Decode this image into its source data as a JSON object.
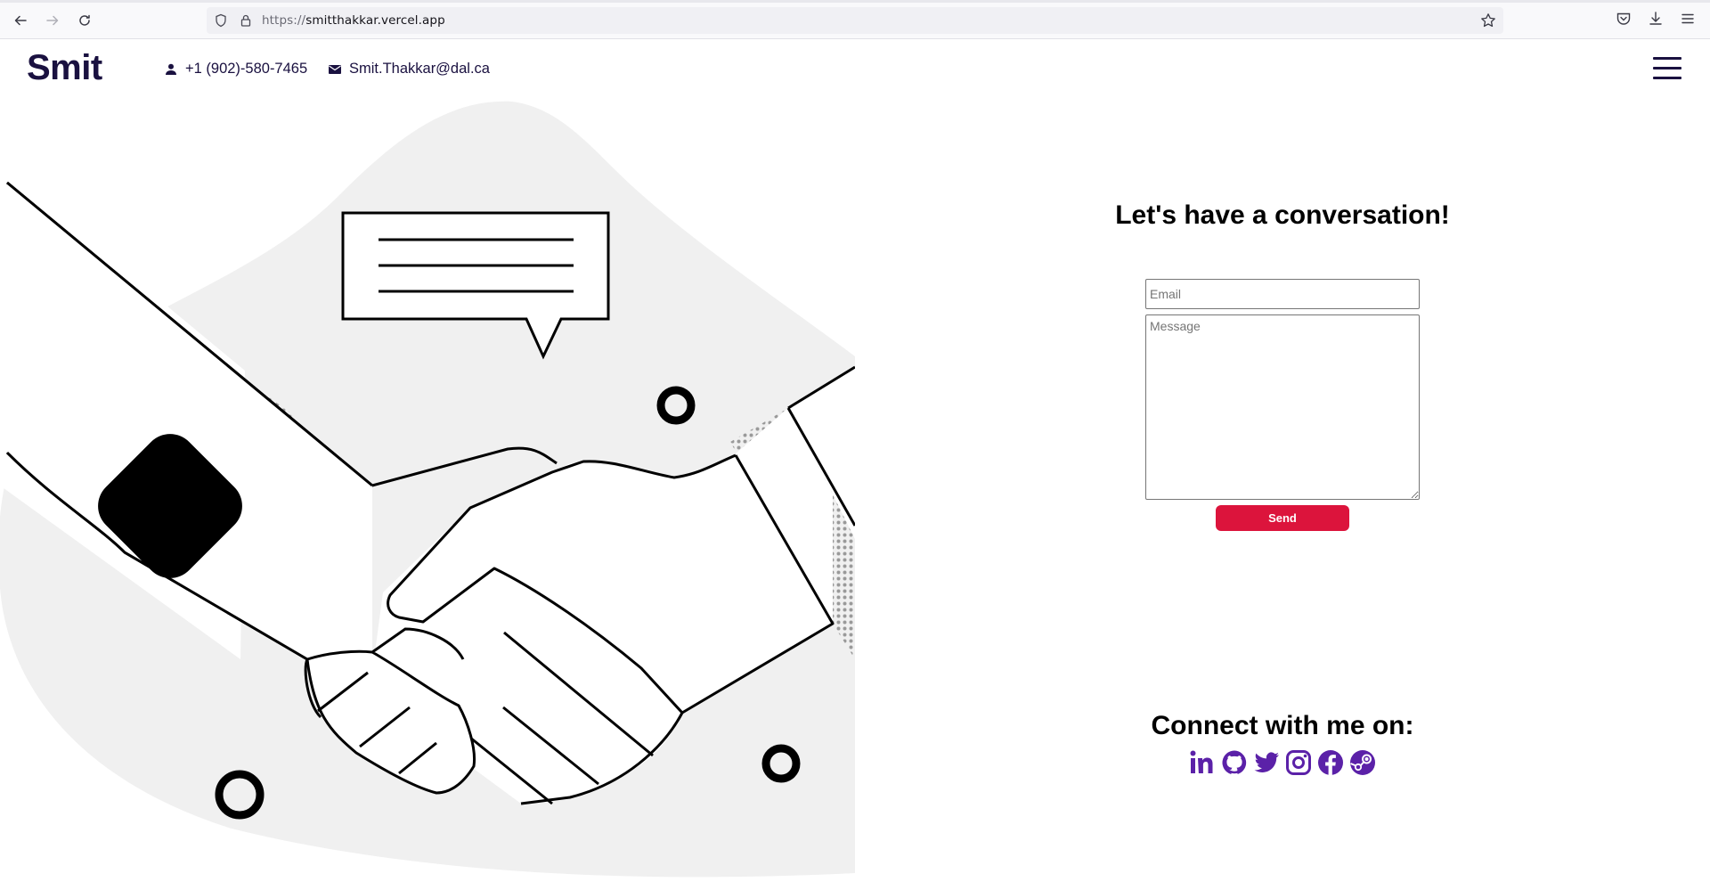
{
  "browser": {
    "url_scheme": "https://",
    "url_host": "smitthakkar.vercel.app"
  },
  "header": {
    "brand": "Smit",
    "phone": "+1 (902)-580-7465",
    "email": "Smit.Thakkar@dal.ca"
  },
  "form": {
    "title": "Let's have a conversation!",
    "email_placeholder": "Email",
    "message_placeholder": "Message",
    "send_label": "Send"
  },
  "social": {
    "title": "Connect with me on:",
    "icons": [
      "linkedin-icon",
      "github-icon",
      "twitter-icon",
      "instagram-icon",
      "facebook-icon",
      "steam-icon"
    ],
    "color": "#5b21a8"
  },
  "colors": {
    "brand": "#1a1140",
    "accent": "#dc143c",
    "social": "#5b21a8"
  }
}
